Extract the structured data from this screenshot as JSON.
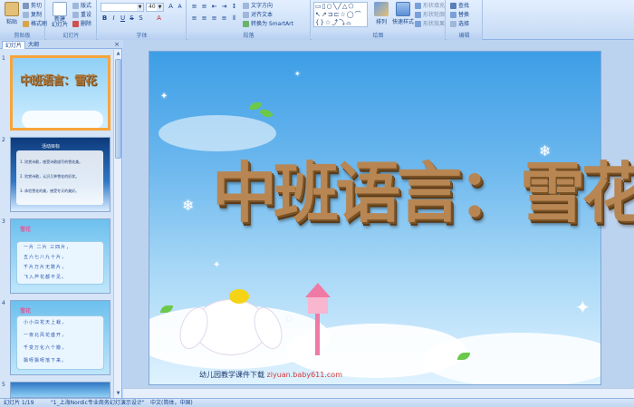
{
  "ribbon": {
    "clipboard": {
      "paste": "粘贴",
      "cut": "剪切",
      "copy": "复制",
      "format_painter": "格式刷",
      "label": "剪贴板"
    },
    "slides": {
      "new_slide": "新建\n幻灯片",
      "layout": "版式",
      "reset": "重设",
      "delete": "删除",
      "label": "幻灯片"
    },
    "font": {
      "size_value": "40",
      "label": "字体"
    },
    "paragraph": {
      "text_direction": "文字方向",
      "align_text": "对齐文本",
      "smartart": "转换为 SmartArt",
      "label": "段落"
    },
    "drawing": {
      "arrange": "排列",
      "quick_styles": "快速样式",
      "shape_fill": "形状填充",
      "shape_outline": "形状轮廓",
      "shape_effects": "形状效果",
      "label": "绘图",
      "shapes_preview": "▭▯○╲╱△⬠\n↖↗⊐⊏☆◯⌒\n{}☆⤴⤵⌓"
    },
    "editing": {
      "find": "查找",
      "replace": "替换",
      "select": "选择",
      "label": "编辑"
    }
  },
  "panel": {
    "tab_slides": "幻灯片",
    "tab_outline": "大纲",
    "close": "×",
    "thumbnails": [
      {
        "num": "1",
        "title": "中班语言：雪花"
      },
      {
        "num": "2",
        "title": "活动目标",
        "lines": [
          "1. 欣赏诗歌，感受诗歌描写的雪花美。",
          "2. 欣赏诗歌，认识几种雪花的形状。",
          "3. 体验雪花的美，感受冬天的美好。"
        ]
      },
      {
        "num": "3",
        "tag": "雪花",
        "lines": [
          "一片 二片 三四片，",
          "五六七八九十片，",
          "千片万片无数片，",
          "飞入芦花都不见。"
        ]
      },
      {
        "num": "4",
        "tag": "雪花",
        "lines": [
          "小小白花天上栽，",
          "一夜北风花盛开，",
          "千变万化六个瓣，",
          "飘呀飘呀落下来。"
        ]
      },
      {
        "num": "5"
      }
    ]
  },
  "slide": {
    "title": "中班语言：雪花",
    "footer_text": "幼儿园教学课件下载",
    "footer_url": "ziyuan.baby611.com"
  },
  "status": {
    "slide_count": "幻灯片 1/19",
    "theme": "\"1_上海Nordic专业商务幻灯演示设计\"",
    "language": "中文(简体，中国)"
  },
  "colors": {
    "ribbon_bg": "#d5e4f7",
    "selected_border": "#f7a43b",
    "title_color": "#b88653"
  }
}
